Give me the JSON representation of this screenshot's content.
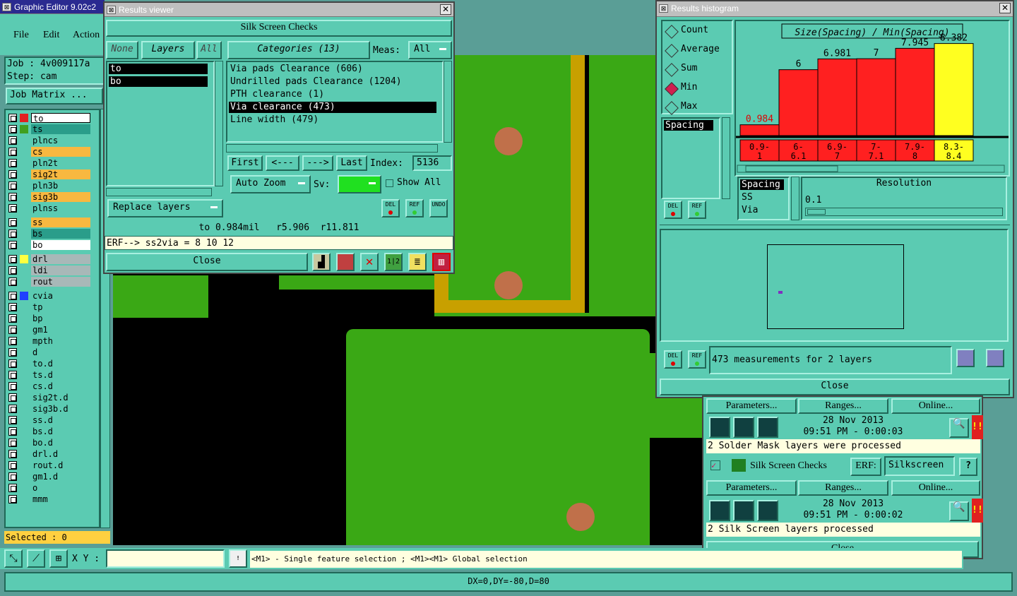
{
  "main_window": {
    "title": "Graphic Editor 9.02c2",
    "menu": [
      "File",
      "Edit",
      "Action"
    ],
    "job": "Job : 4v009117a",
    "step": "Step: cam",
    "matrix_btn": "Job Matrix ...",
    "selected": "Selected : 0",
    "xy_label": "X Y :",
    "status_msg": "<M1> - Single feature selection ; <M1><M1> Global selection",
    "coords": "DX=0,DY=-80,D=80",
    "layers": [
      "to",
      "ts",
      "plncs",
      "cs",
      "pln2t",
      "sig2t",
      "pln3b",
      "sig3b",
      "plnss",
      "ss",
      "bs",
      "bo",
      "drl",
      "ldi",
      "rout",
      "cvia",
      "tp",
      "bp",
      "gm1",
      "mpth",
      "d",
      "to.d",
      "ts.d",
      "cs.d",
      "sig2t.d",
      "sig3b.d",
      "ss.d",
      "bs.d",
      "bo.d",
      "drl.d",
      "rout.d",
      "gm1.d",
      "o",
      "mmm"
    ]
  },
  "results_viewer": {
    "title": "Results viewer",
    "header": "Silk Screen Checks",
    "none_btn": "None",
    "layers_btn": "Layers",
    "all_btn": "All",
    "categories_btn": "Categories (13)",
    "meas_label": "Meas:",
    "meas_value": "All",
    "layer_list": [
      "to",
      "bo"
    ],
    "categories": [
      "Via pads Clearance (606)",
      "Undrilled pads Clearance (1204)",
      "PTH clearance (1)",
      "Via clearance (473)",
      "Line width (479)"
    ],
    "nav": {
      "first": "First",
      "prev": "<---",
      "next": "--->",
      "last": "Last",
      "index_label": "Index:",
      "index_value": "5136"
    },
    "auto_zoom": "Auto Zoom",
    "sv_label": "Sv:",
    "show_all": "Show All",
    "replace_layers": "Replace layers",
    "del": "DEL",
    "ref": "REF",
    "undo": "UNDO",
    "info": "to 0.984mil   r5.906  r11.811",
    "erf": "ERF--> ss2via = 8 10 12",
    "close": "Close"
  },
  "histogram": {
    "title": "Results histogram",
    "options": [
      "Count",
      "Average",
      "Sum",
      "Min",
      "Max"
    ],
    "selected_option": "Min",
    "chart_title": "Size(Spacing) / Min(Spacing)",
    "measure_list": [
      "Spacing"
    ],
    "layer_list": [
      "Spacing",
      "SS",
      "Via"
    ],
    "resolution_label": "Resolution",
    "resolution_value": "0.1",
    "del": "DEL",
    "ref": "REF",
    "summary": "473 measurements for 2 layers",
    "close": "Close"
  },
  "chart_data": {
    "type": "bar",
    "categories": [
      "0.9-1",
      "6-6.1",
      "6.9-7",
      "7-7.1",
      "7.9-8",
      "8.3-8.4"
    ],
    "values": [
      0.984,
      6,
      6.981,
      7,
      7.945,
      8.382
    ],
    "value_labels": [
      "0.984",
      "6",
      "6.981",
      "7",
      "7.945",
      "8.382"
    ],
    "ylim": [
      0,
      9
    ],
    "title": "Size(Spacing) / Min(Spacing)",
    "colors": [
      "#ff2020",
      "#ff2020",
      "#ff2020",
      "#ff2020",
      "#ff2020",
      "#ffff20"
    ]
  },
  "checks": {
    "params": "Parameters...",
    "ranges": "Ranges...",
    "online": "Online...",
    "row1_date": "28 Nov 2013",
    "row1_time": "09:51 PM - 0:00:03",
    "row1_msg": "2 Solder Mask layers were processed",
    "silk_label": "Silk Screen Checks",
    "erf_label": "ERF:",
    "erf_value": "Silkscreen",
    "help": "?",
    "row2_date": "28 Nov 2013",
    "row2_time": "09:51 PM - 0:00:02",
    "row2_msg": "2 Silk Screen layers processed",
    "close": "Close"
  }
}
